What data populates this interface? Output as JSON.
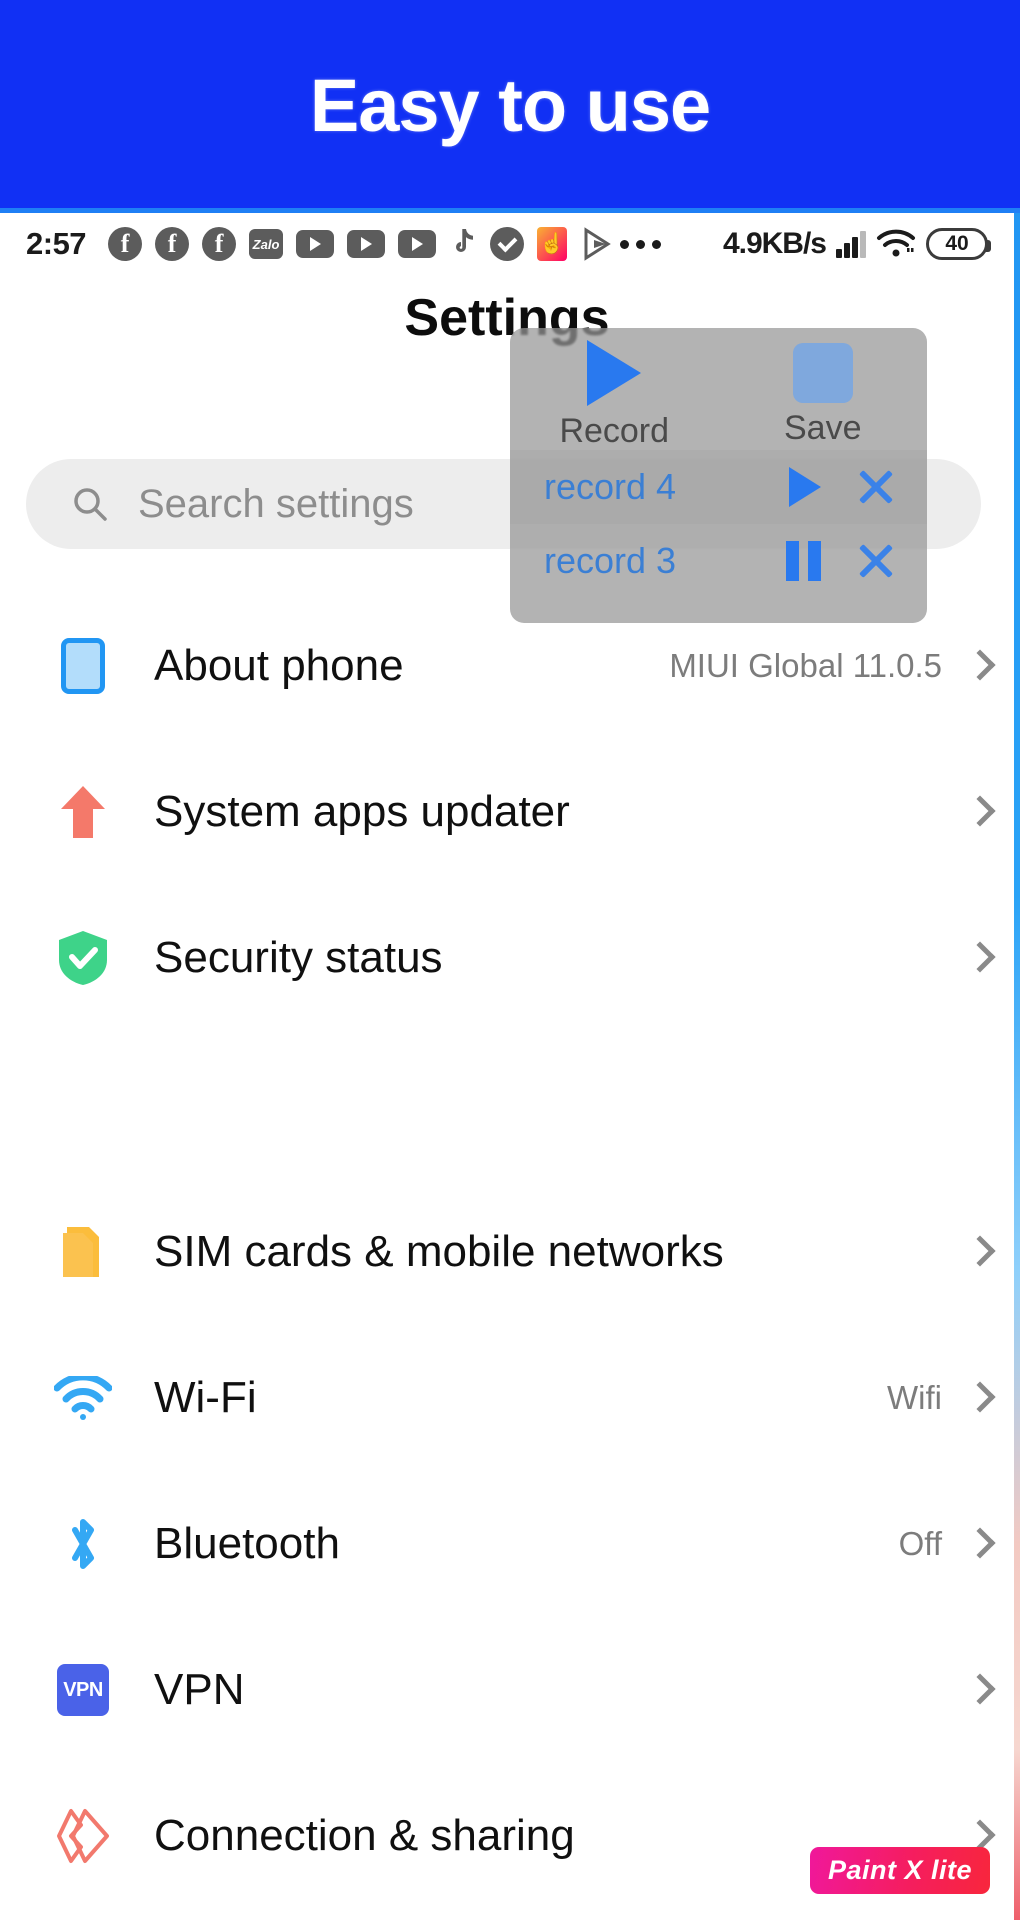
{
  "banner": {
    "text": "Easy to use",
    "bg_color": "#1130F4"
  },
  "status_bar": {
    "clock": "2:57",
    "network_speed": "4.9KB/s",
    "battery_level": "40",
    "app_icons": [
      {
        "name": "facebook-icon",
        "label": "f"
      },
      {
        "name": "facebook-icon",
        "label": "f"
      },
      {
        "name": "facebook-icon",
        "label": "f"
      },
      {
        "name": "zalo-icon",
        "label": "Zalo"
      },
      {
        "name": "youtube-icon",
        "label": ""
      },
      {
        "name": "youtube-icon",
        "label": ""
      },
      {
        "name": "youtube-icon",
        "label": ""
      },
      {
        "name": "tiktok-icon",
        "label": ""
      },
      {
        "name": "check-circle-icon",
        "label": ""
      },
      {
        "name": "likee-icon",
        "label": "☝"
      },
      {
        "name": "play-store-icon",
        "label": ""
      }
    ],
    "overflow_icon": "more-dots-icon",
    "signal_icon": "cellular-signal-icon",
    "wifi_icon": "wifi-icon",
    "battery_icon": "battery-icon"
  },
  "header": {
    "title": "Settings"
  },
  "search": {
    "placeholder": "Search settings",
    "value": "",
    "icon": "search-icon"
  },
  "settings_groups": [
    {
      "items": [
        {
          "icon": "phone-icon",
          "label": "About phone",
          "value": "MIUI Global 11.0.5"
        },
        {
          "icon": "arrow-up-icon",
          "label": "System apps updater",
          "value": ""
        },
        {
          "icon": "shield-check-icon",
          "label": "Security status",
          "value": ""
        }
      ]
    },
    {
      "items": [
        {
          "icon": "sim-card-icon",
          "label": "SIM cards & mobile networks",
          "value": ""
        },
        {
          "icon": "wifi-icon",
          "label": "Wi-Fi",
          "value": "Wifi"
        },
        {
          "icon": "bluetooth-icon",
          "label": "Bluetooth",
          "value": "Off"
        },
        {
          "icon": "vpn-icon",
          "label": "VPN",
          "value": ""
        },
        {
          "icon": "connection-sharing-icon",
          "label": "Connection & sharing",
          "value": ""
        }
      ]
    }
  ],
  "recorder_overlay": {
    "record_button": {
      "label": "Record",
      "icon": "play-triangle-icon"
    },
    "save_button": {
      "label": "Save",
      "icon": "stop-square-icon"
    },
    "recordings": [
      {
        "name": "record 4",
        "action_icon": "play-icon",
        "delete_icon": "close-x-icon"
      },
      {
        "name": "record 3",
        "action_icon": "pause-icon",
        "delete_icon": "close-x-icon"
      }
    ],
    "accent_color": "#2979ef"
  },
  "watermark": {
    "text": "Paint X lite"
  },
  "chevron_icon": "chevron-right-icon"
}
